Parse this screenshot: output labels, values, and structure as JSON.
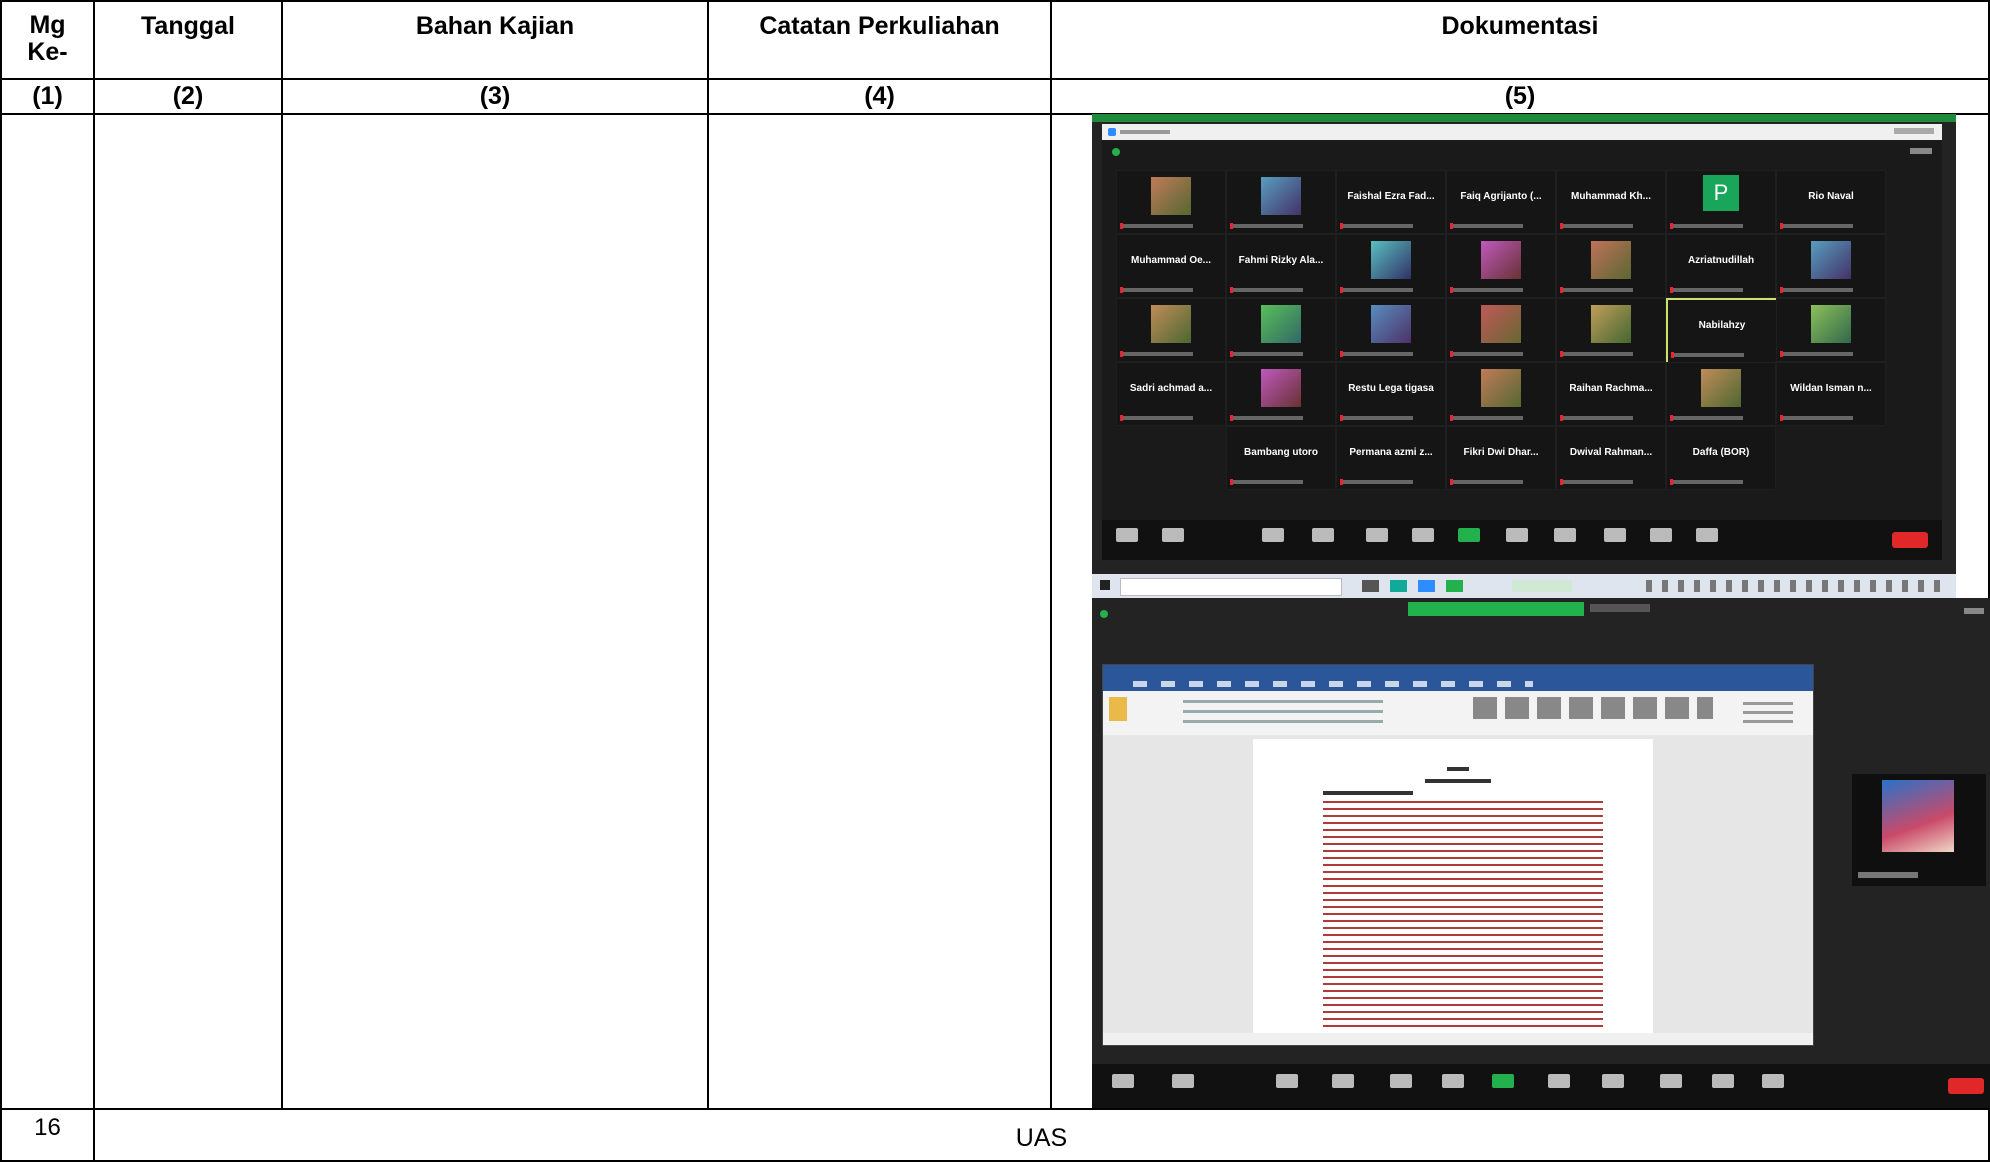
{
  "table": {
    "headers": {
      "mg": [
        "Mg",
        "Ke-"
      ],
      "tanggal": "Tanggal",
      "bahan": "Bahan Kajian",
      "catatan": "Catatan Perkuliahan",
      "dokumentasi": "Dokumentasi"
    },
    "numbers": [
      "(1)",
      "(2)",
      "(3)",
      "(4)",
      "(5)"
    ],
    "last_row": {
      "week": "16",
      "content": "UAS"
    }
  },
  "zoom_gallery": {
    "names": [
      "",
      "",
      "Faishal Ezra Fad...",
      "Faiq Agrijanto (...",
      "Muhammad Kh...",
      "P",
      "Rio Naval",
      "Muhammad Oe...",
      "Fahmi Rizky Ala...",
      "",
      "",
      "",
      "Azriatnudillah",
      "",
      "",
      "",
      "",
      "",
      "",
      "Nabilahzy",
      "",
      "Sadri achmad a...",
      "",
      "Restu Lega tigasa",
      "",
      "Raihan Rachma...",
      "",
      "Wildan Isman n...",
      "",
      "Bambang utoro",
      "Permana azmi z...",
      "Fikri Dwi Dhar...",
      "Dwival Rahman...",
      "Daffa (BOR)",
      ""
    ]
  },
  "colors": {
    "zoom_bg": "#1c1c1c",
    "accent_green": "#23b14d",
    "word_blue": "#2b579a",
    "end_red": "#e02828",
    "avatar_green": "#1aa65a"
  }
}
